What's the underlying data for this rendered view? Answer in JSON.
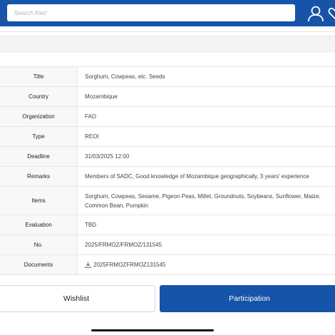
{
  "search": {
    "placeholder": "Search Klet!"
  },
  "header_icons": [
    "user-icon",
    "heart-icon"
  ],
  "details": [
    {
      "key": "Title",
      "value": "Sorghum, Cowpeas, etc. Seeds"
    },
    {
      "key": "Country",
      "value": "Mozambique"
    },
    {
      "key": "Organization",
      "value": "FAO"
    },
    {
      "key": "Type",
      "value": "REOI"
    },
    {
      "key": "Deadline",
      "value": "31/03/2025 12:00"
    },
    {
      "key": "Remarks",
      "value": "Members of SADC, Good knowledge of Mozambique geographically, 3 years' experience"
    },
    {
      "key": "Items",
      "value": "Sorghum, Cowpeas, Sesame, Pigeon Peas, Millet, Groundnuts, Soybeans, Sunflower, Maize, Common Bean, Pumpkin"
    },
    {
      "key": "Evaluation",
      "value": "TBD"
    },
    {
      "key": "No.",
      "value": "2025/FRMOZ/FRMOZ/131545"
    },
    {
      "key": "Documents",
      "value": "2025FRMOZFRMOZ131545",
      "icon": "download-icon"
    }
  ],
  "buttons": {
    "wishlist": "Wishlist",
    "participation": "Participation"
  },
  "colors": {
    "brand": "#1554a8",
    "label_bg": "#f7f8fa"
  }
}
